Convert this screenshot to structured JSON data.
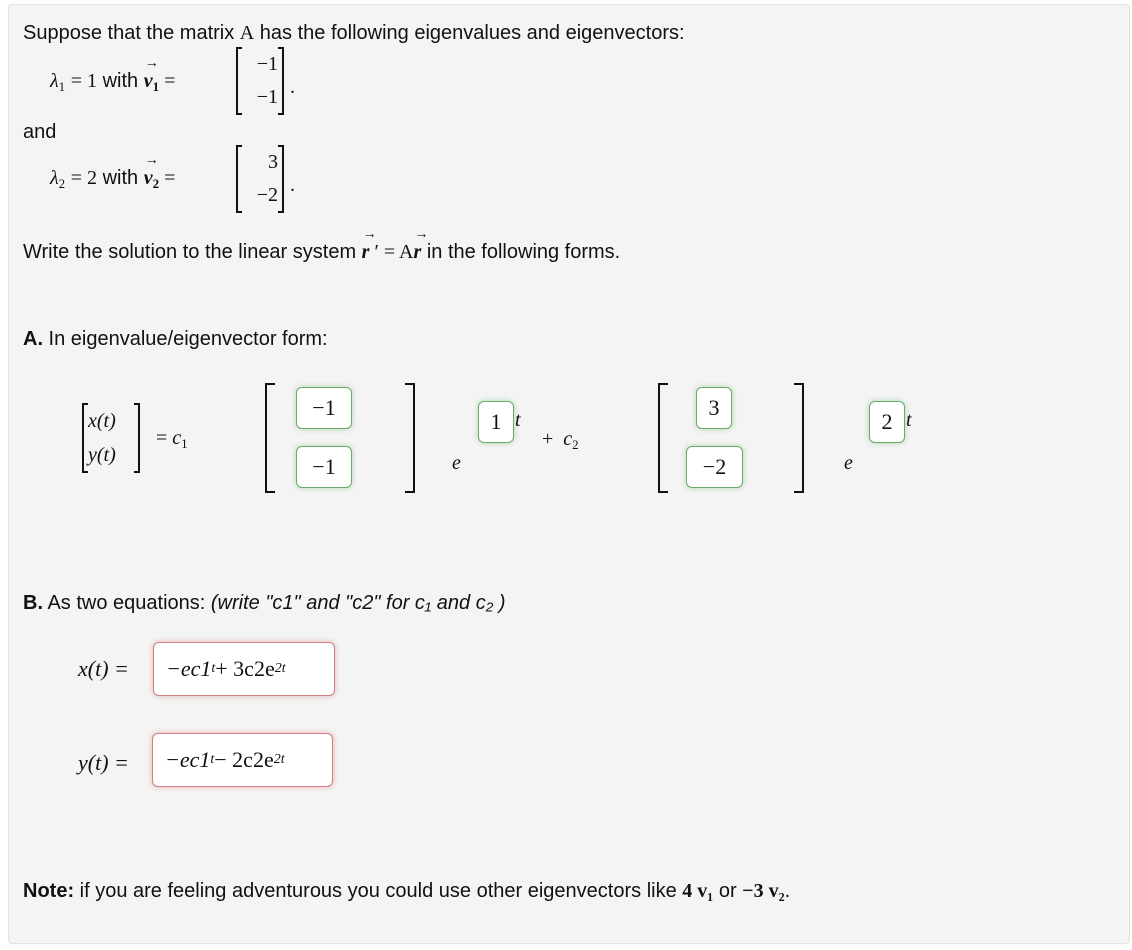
{
  "intro": {
    "line1_pre": "Suppose that the matrix ",
    "matrix_symbol": "A",
    "line1_post": " has the following eigenvalues and eigenvectors:",
    "and_label": "and",
    "eig1": {
      "lambda": "λ",
      "index": "1",
      "value": "1",
      "with": " with ",
      "vec": "v",
      "vec_index": "1",
      "entries": [
        "−1",
        "−1"
      ]
    },
    "eig2": {
      "lambda": "λ",
      "index": "2",
      "value": "2",
      "with": " with ",
      "vec": "v",
      "vec_index": "2",
      "entries": [
        "3",
        "−2"
      ]
    },
    "system_pre": "Write the solution to the linear system ",
    "system_post": " in the following forms."
  },
  "partA": {
    "label": "A.",
    "text": " In eigenvalue/eigenvector form:",
    "lhs": [
      "x(t)",
      "y(t)"
    ],
    "c1": "c",
    "c2": "c",
    "plus": "+",
    "e": "e",
    "t": "t",
    "answers": {
      "v1_top": "−1",
      "v1_bottom": "−1",
      "exp1": "1",
      "v2_top": "3",
      "v2_bottom": "−2",
      "exp2": "2"
    },
    "answer_status_color": "#6aa96a"
  },
  "partB": {
    "label": "B.",
    "text": " As two equations: ",
    "hint": "(write \"c1\" and \"c2\" for c₁ and c₂ )",
    "x_label": "x(t) =",
    "y_label": "y(t) =",
    "x_answer": {
      "base": "−ec1",
      "sup1": "t",
      "mid": " + 3c2e",
      "sup2": "2t"
    },
    "y_answer": {
      "base": "−ec1",
      "sup1": "t",
      "mid": " − 2c2e",
      "sup2": "2t"
    },
    "answer_status_color": "#d08080"
  },
  "note": {
    "label": "Note:",
    "text": " if you are feeling adventurous you could use other eigenvectors like ",
    "ex1": "4 v₁",
    "or": " or ",
    "ex2": "−3 v₂",
    "end": "."
  }
}
